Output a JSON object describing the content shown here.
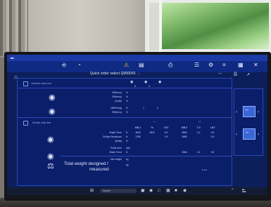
{
  "window": {
    "title": "Quick order select Q000041 →"
  },
  "section1": {
    "header": "Oversize order test"
  },
  "section2": {
    "header": "Moulds order test"
  },
  "rows_section1": [
    {
      "label": "Efficiency",
      "unit": "%"
    },
    {
      "label": "Efficiency",
      "unit": "%"
    },
    {
      "label": "Quality",
      "unit": "%"
    },
    {
      "label": "Diff/Energy",
      "unit": "%"
    },
    {
      "label": "Efficiency",
      "unit": "%"
    }
  ],
  "section1_values": [
    "0",
    "0",
    "7",
    "0"
  ],
  "columns2": [
    "MB-1",
    "%",
    "t-R1",
    "MB-2",
    "T-S",
    "t-R2"
  ],
  "rows_section2": [
    {
      "label": "Brake Force",
      "unit": "N",
      "values": [
        "3040",
        "3374",
        "0.0",
        "3000",
        "1.0",
        "0.0"
      ]
    },
    {
      "label": "Rollbar Resistance",
      "unit": "N",
      "values": [
        "1750",
        "",
        "1.9",
        "1550",
        "",
        "0.0"
      ]
    },
    {
      "label": "Quality",
      "unit": "%",
      "values": [
        "",
        "",
        "",
        "",
        "",
        ""
      ]
    },
    {
      "label": "Pedal force",
      "unit": "daN",
      "values": [
        "",
        "",
        "",
        "",
        "",
        ""
      ]
    },
    {
      "label": "Brake Force",
      "unit": "N",
      "values": [
        "",
        "",
        "",
        "2340",
        "1.0",
        "0.0"
      ]
    },
    {
      "label": "Axle weight",
      "unit": "kg",
      "values": [
        "",
        "",
        "",
        "",
        "",
        ""
      ]
    }
  ],
  "total": {
    "label_line1": "Total weight designed /",
    "label_line2": "measured",
    "unit": "kg"
  },
  "gauge": {
    "top_value": "+0",
    "bottom_value": "+0"
  },
  "taskbar": {
    "search_placeholder": "Search"
  },
  "icons": {
    "home": "home-icon",
    "car": "car-icon",
    "gauge": "gauge-icon",
    "warning": "warning-icon",
    "printer": "printer-icon",
    "tire": "tire-icon",
    "brake": "brake-icon",
    "weight": "weight-icon"
  },
  "colors": {
    "screen_bg": "#0c1f5a",
    "panel_bg": "#0b1e6a",
    "accent": "#1b3aa5",
    "warn": "#ffcc33"
  }
}
